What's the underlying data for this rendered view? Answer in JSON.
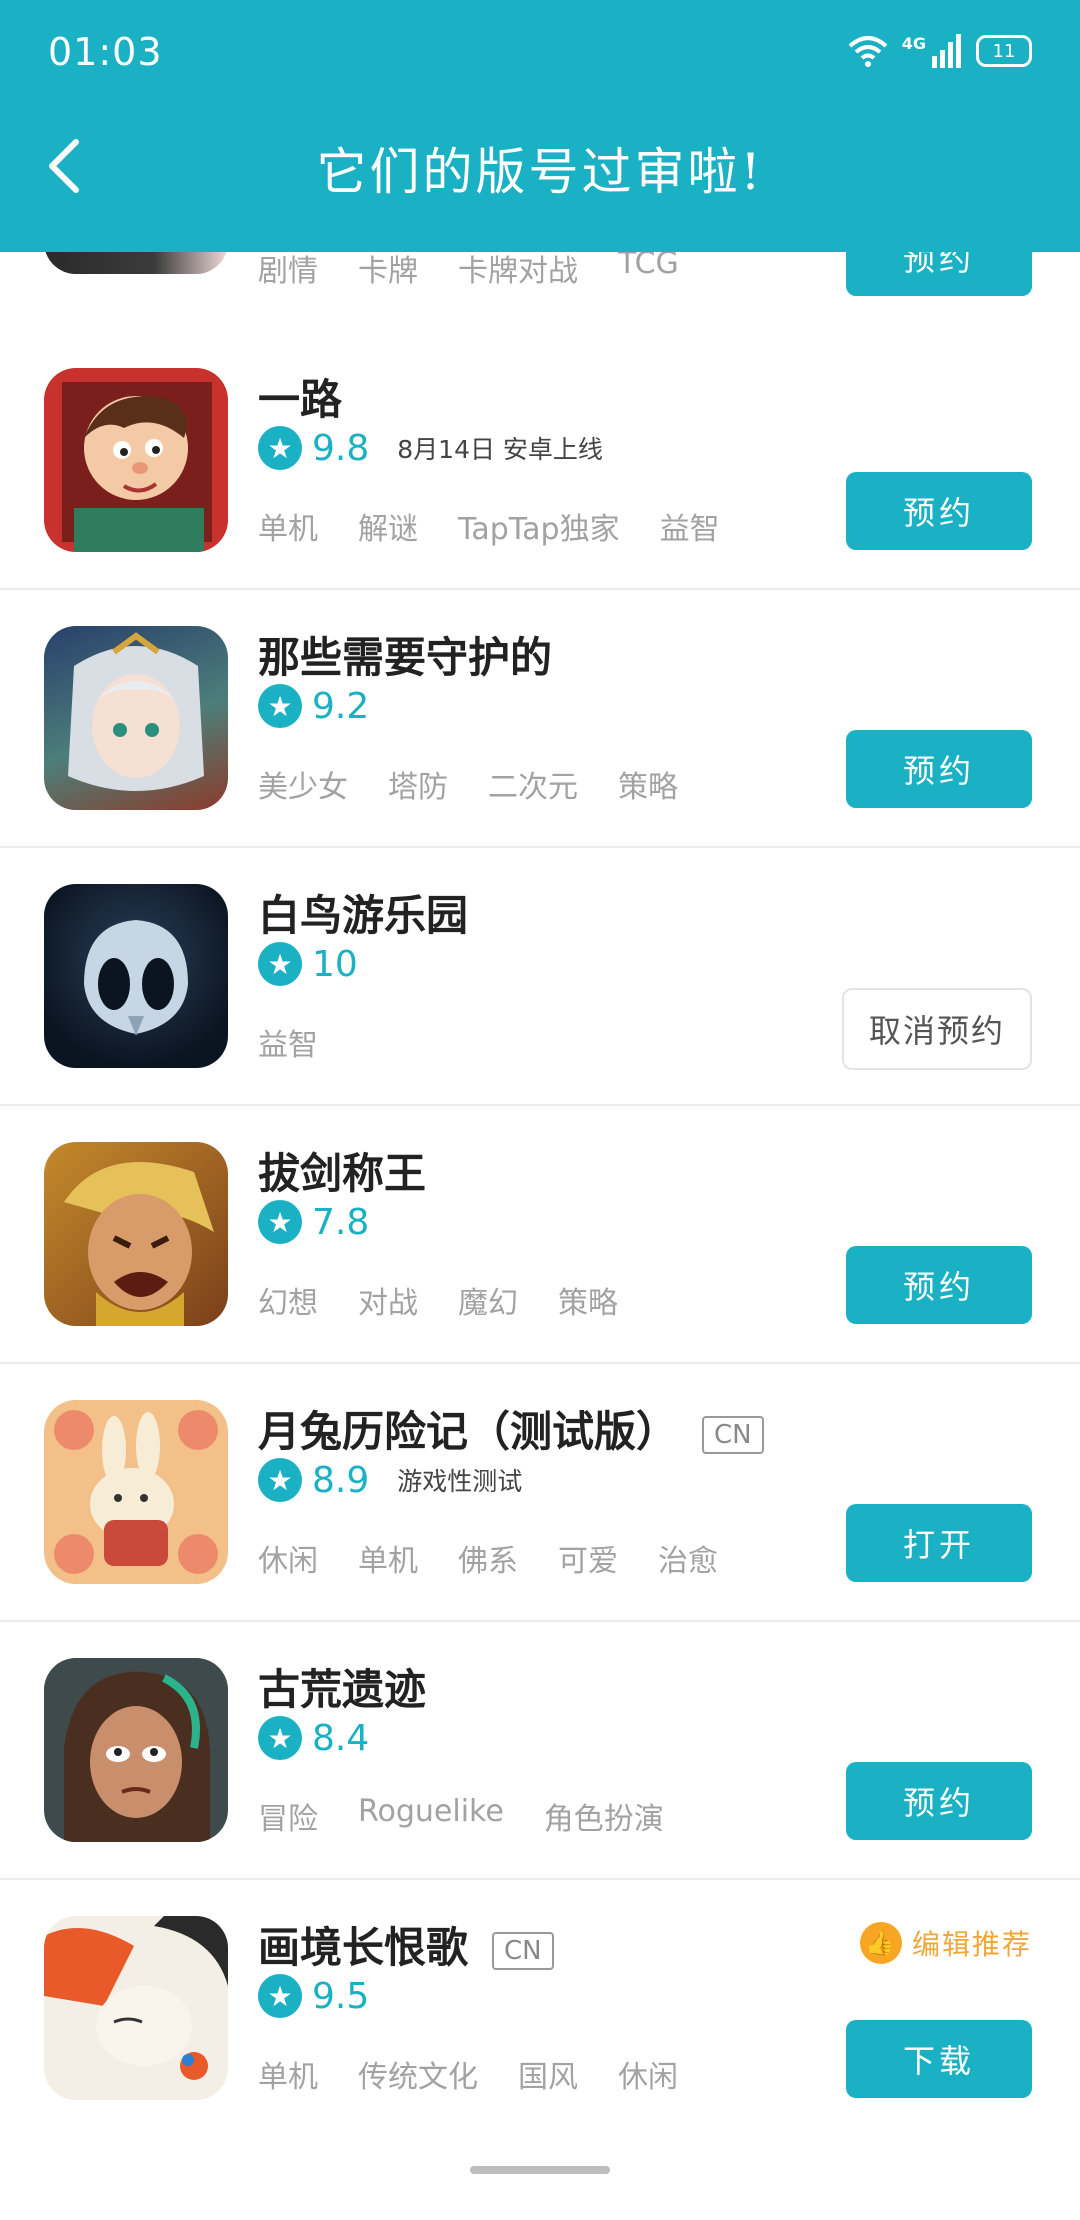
{
  "status_bar": {
    "time": "01:03",
    "network": "4G",
    "battery": "11"
  },
  "header": {
    "title": "它们的版号过审啦!",
    "back_icon": "back-arrow-icon"
  },
  "apps": [
    {
      "name": "",
      "rating": "",
      "note": "",
      "tags": [
        "剧情",
        "卡牌",
        "卡牌对战",
        "TCG"
      ],
      "button": "预约"
    },
    {
      "name": "一路",
      "rating": "9.8",
      "note": "8月14日  安卓上线",
      "tags": [
        "单机",
        "解谜",
        "TapTap独家",
        "益智"
      ],
      "button": "预约"
    },
    {
      "name": "那些需要守护的",
      "rating": "9.2",
      "note": "",
      "tags": [
        "美少女",
        "塔防",
        "二次元",
        "策略"
      ],
      "button": "预约"
    },
    {
      "name": "白鸟游乐园",
      "rating": "10",
      "note": "",
      "tags": [
        "益智"
      ],
      "button": "取消预约"
    },
    {
      "name": "拔剑称王",
      "rating": "7.8",
      "note": "",
      "tags": [
        "幻想",
        "对战",
        "魔幻",
        "策略"
      ],
      "button": "预约"
    },
    {
      "name": "月兔历险记（测试版）",
      "badge": "CN",
      "rating": "8.9",
      "note": "游戏性测试",
      "tags": [
        "休闲",
        "单机",
        "佛系",
        "可爱",
        "治愈"
      ],
      "button": "打开"
    },
    {
      "name": "古荒遗迹",
      "rating": "8.4",
      "note": "",
      "tags": [
        "冒险",
        "Roguelike",
        "角色扮演"
      ],
      "button": "预约"
    },
    {
      "name": "画境长恨歌",
      "badge": "CN",
      "rating": "9.5",
      "note": "",
      "editor_pick": "编辑推荐",
      "tags": [
        "单机",
        "传统文化",
        "国风",
        "休闲"
      ],
      "button": "下载"
    }
  ],
  "colors": {
    "accent": "#1ab1c4",
    "editor_pick": "#f6a623"
  }
}
